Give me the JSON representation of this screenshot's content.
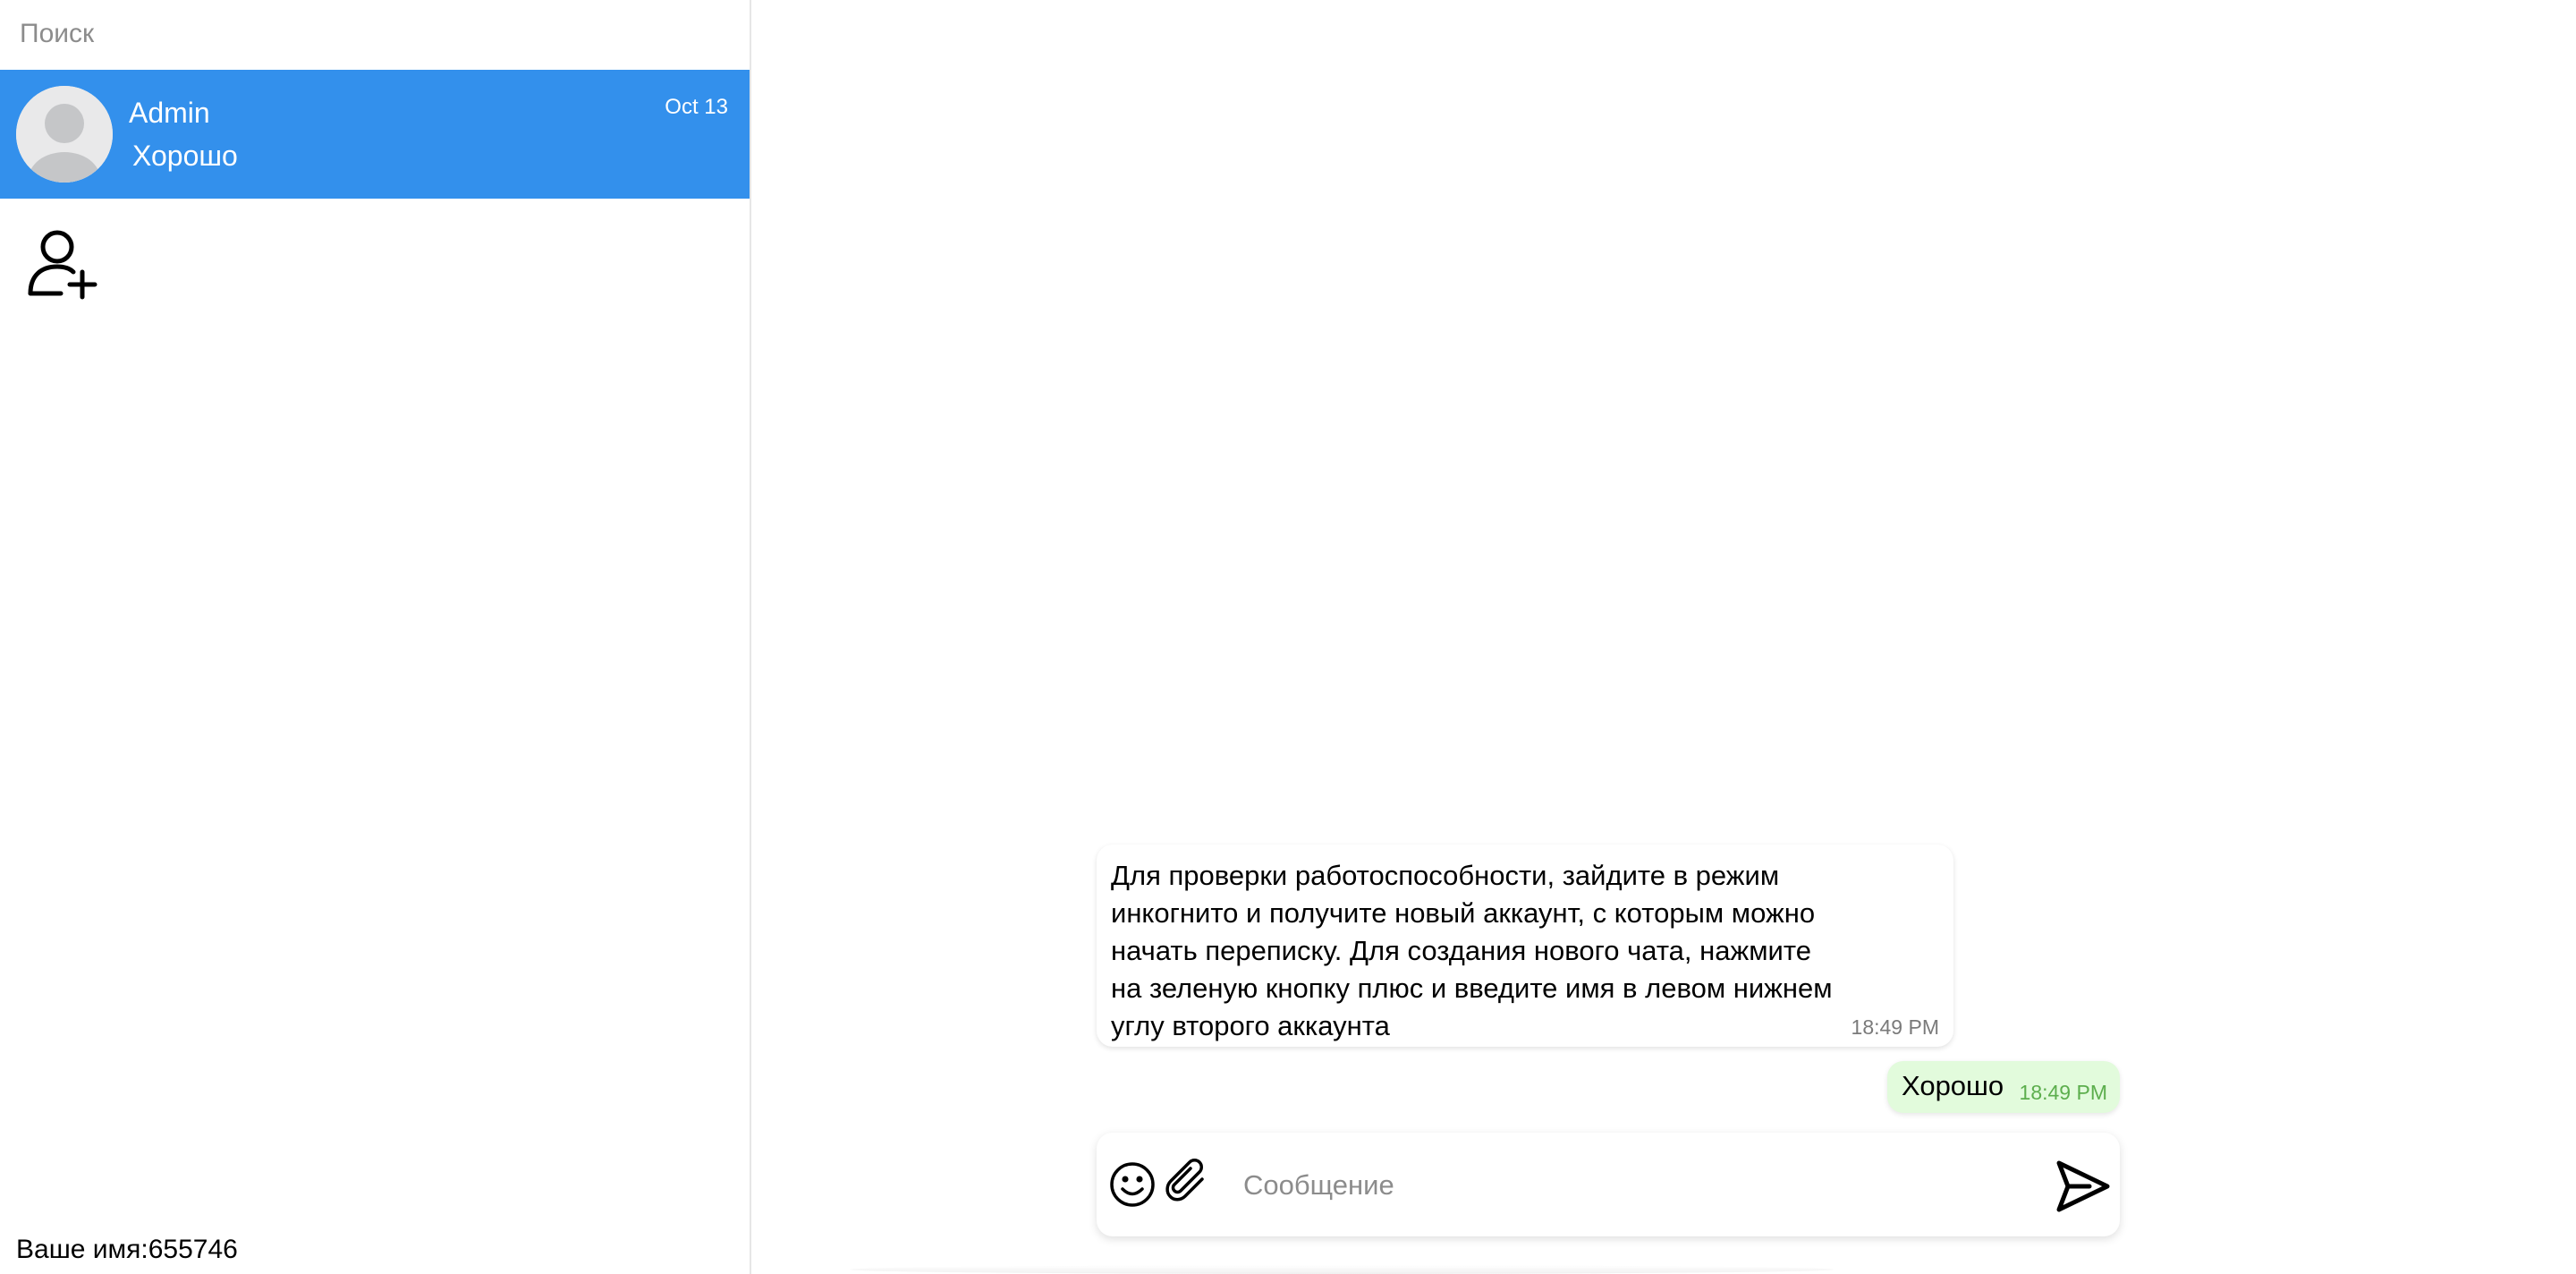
{
  "sidebar": {
    "search_placeholder": "Поиск",
    "chats": [
      {
        "name": "Admin",
        "last_message": "Хорошо",
        "date": "Oct 13",
        "icon": "default-avatar-icon"
      }
    ],
    "add_user_icon": "add-user-icon",
    "your_name": "Ваше имя:655746"
  },
  "messages": [
    {
      "direction": "incoming",
      "text": "Для проверки работоспособности, зайдите в режим инкогнито и получите новый аккаунт, с которым можно начать переписку. Для создания нового чата, нажмите на зеленую кнопку плюс и введите имя в левом нижнем углу второго аккаунта",
      "time": "18:49 PM"
    },
    {
      "direction": "outgoing",
      "text": "Хорошо",
      "time": "18:49 PM"
    }
  ],
  "composer": {
    "placeholder": "Сообщение",
    "icons": [
      "smile-icon",
      "paperclip-icon",
      "send-icon"
    ]
  },
  "colors": {
    "selected_chat": "#3390ec",
    "outgoing_bubble": "#e2fbdc",
    "outgoing_time": "#5cae4d"
  }
}
